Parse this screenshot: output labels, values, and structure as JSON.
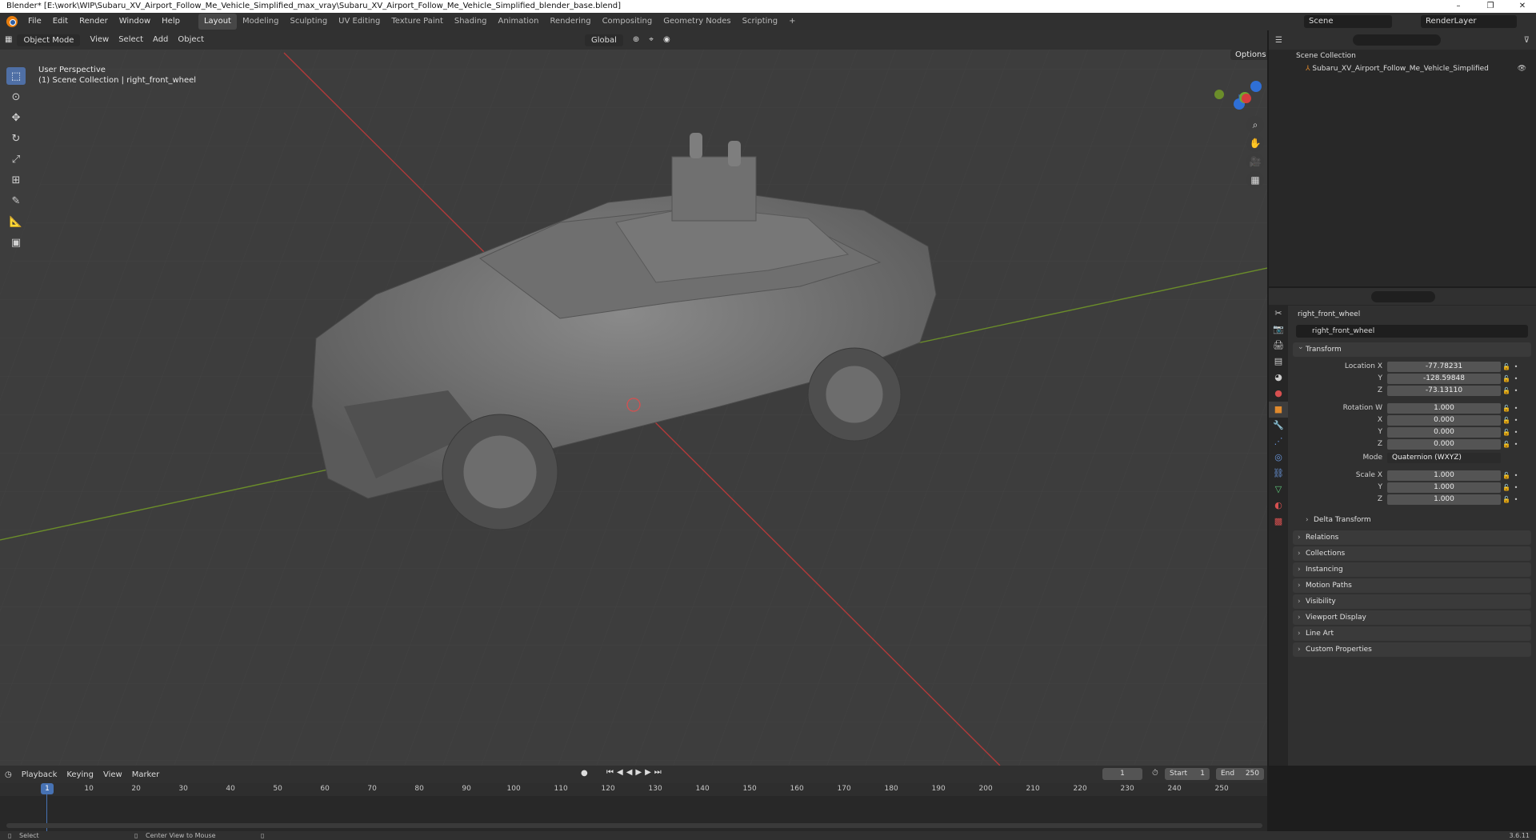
{
  "window": {
    "title": "Blender* [E:\\work\\WIP\\Subaru_XV_Airport_Follow_Me_Vehicle_Simplified_max_vray\\Subaru_XV_Airport_Follow_Me_Vehicle_Simplified_blender_base.blend]",
    "min": "–",
    "max": "❐",
    "close": "✕"
  },
  "menu": [
    "File",
    "Edit",
    "Render",
    "Window",
    "Help"
  ],
  "workspaces": [
    {
      "label": "Layout",
      "active": true
    },
    {
      "label": "Modeling"
    },
    {
      "label": "Sculpting"
    },
    {
      "label": "UV Editing"
    },
    {
      "label": "Texture Paint"
    },
    {
      "label": "Shading"
    },
    {
      "label": "Animation"
    },
    {
      "label": "Rendering"
    },
    {
      "label": "Compositing"
    },
    {
      "label": "Geometry Nodes"
    },
    {
      "label": "Scripting"
    },
    {
      "label": "+"
    }
  ],
  "scene": "Scene",
  "render_layer": "RenderLayer",
  "viewport": {
    "mode": "Object Mode",
    "menus": [
      "View",
      "Select",
      "Add",
      "Object"
    ],
    "orientation": "Global",
    "options": "Options",
    "perspective": "User Perspective",
    "collection_info": "(1) Scene Collection | right_front_wheel"
  },
  "outliner": {
    "root": "Scene Collection",
    "item": "Subaru_XV_Airport_Follow_Me_Vehicle_Simplified"
  },
  "properties": {
    "object_name": "right_front_wheel",
    "data_name": "right_front_wheel",
    "transform_title": "Transform",
    "location": {
      "label": "Location X",
      "x": "-77.78231",
      "y": "-128.59848",
      "z": "-73.13110"
    },
    "rotation": {
      "label": "Rotation W",
      "w": "1.000",
      "x": "0.000",
      "y": "0.000",
      "z": "0.000"
    },
    "mode_label": "Mode",
    "mode_value": "Quaternion (WXYZ)",
    "scale": {
      "label": "Scale X",
      "x": "1.000",
      "y": "1.000",
      "z": "1.000"
    },
    "axis_y": "Y",
    "axis_z": "Z",
    "axis_x": "X",
    "delta": "Delta Transform",
    "panels": [
      "Relations",
      "Collections",
      "Instancing",
      "Motion Paths",
      "Visibility",
      "Viewport Display",
      "Line Art",
      "Custom Properties"
    ]
  },
  "timeline": {
    "menus": [
      "Playback",
      "Keying",
      "View",
      "Marker"
    ],
    "current_frame": "1",
    "start_label": "Start",
    "start": "1",
    "end_label": "End",
    "end": "250",
    "ticks": [
      "10",
      "20",
      "30",
      "40",
      "50",
      "60",
      "70",
      "80",
      "90",
      "100",
      "110",
      "120",
      "130",
      "140",
      "150",
      "160",
      "170",
      "180",
      "190",
      "200",
      "210",
      "220",
      "230",
      "240",
      "250"
    ],
    "marker": "1"
  },
  "status": {
    "select": "Select",
    "center": "Center View to Mouse",
    "version": "3.6.11"
  },
  "gizmo": {
    "x": "X",
    "y": "Y",
    "z": "Z"
  }
}
